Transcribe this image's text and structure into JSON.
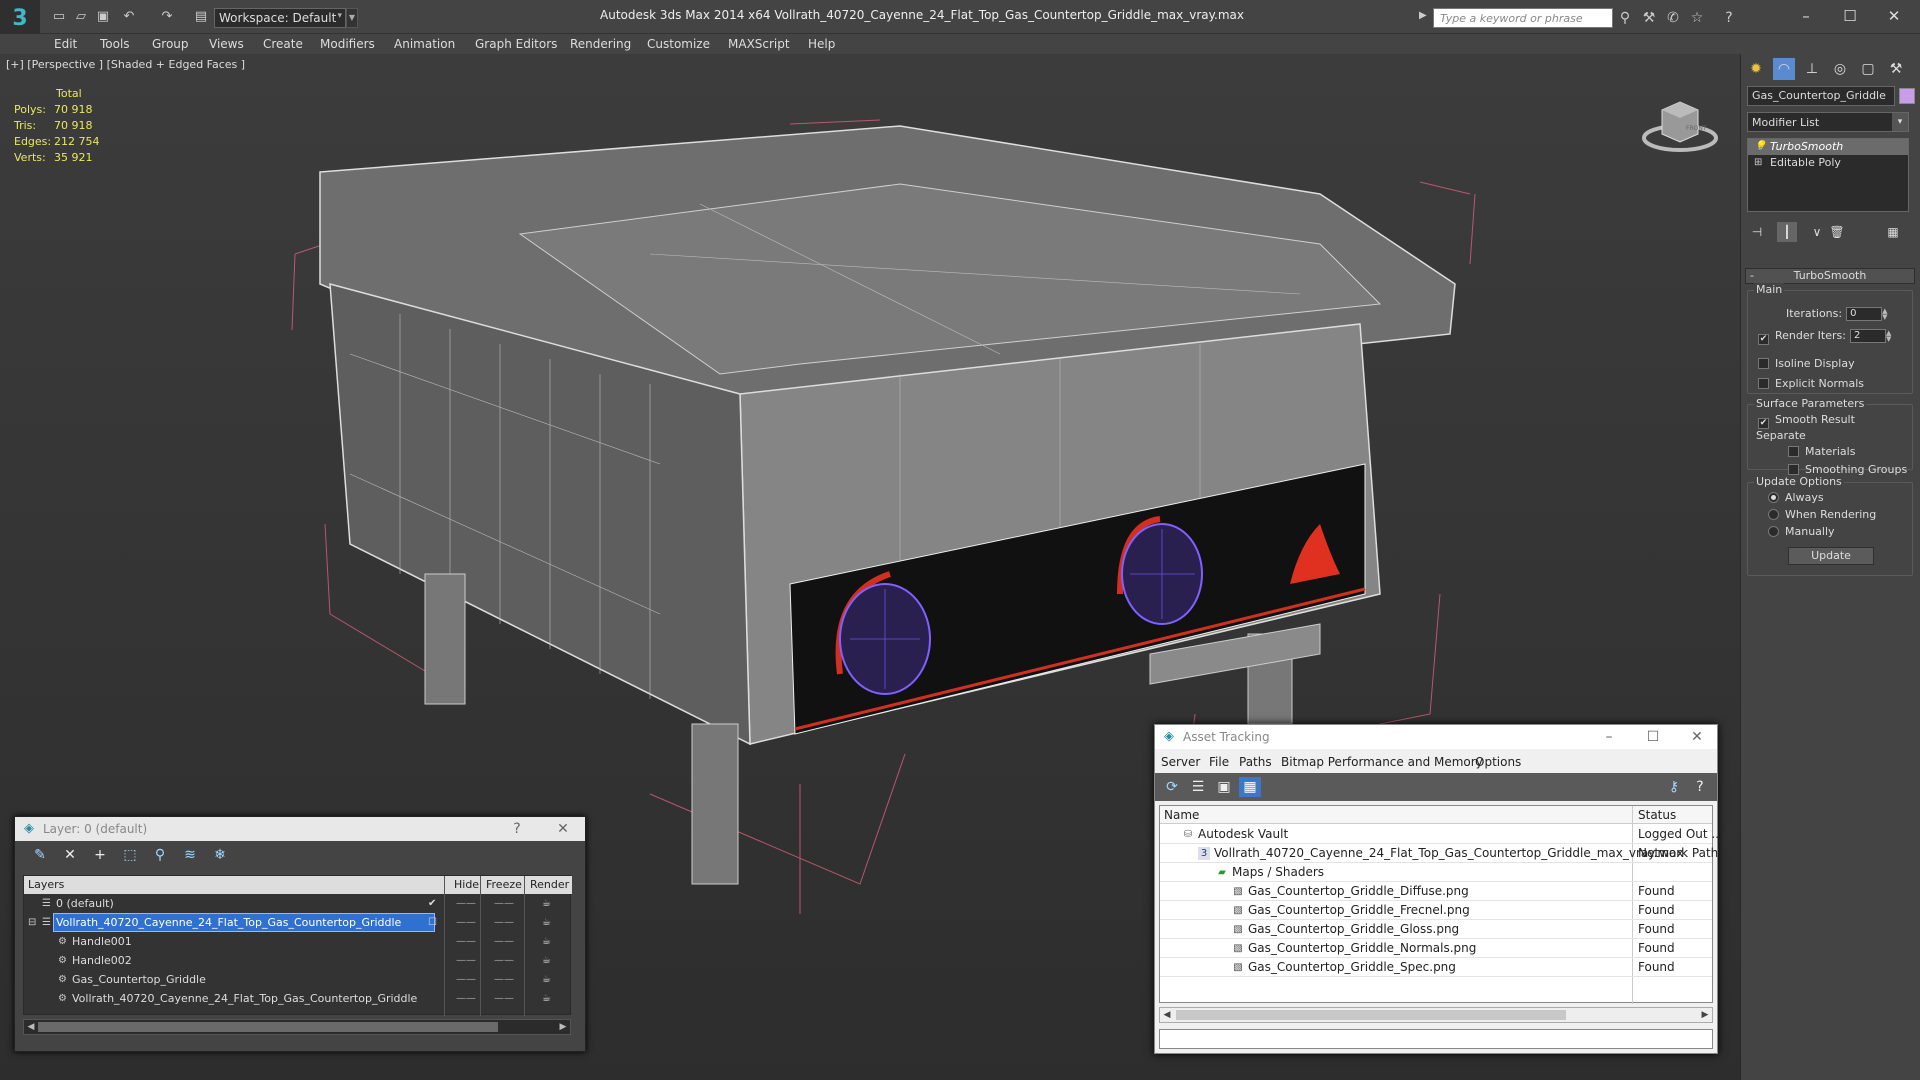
{
  "app": {
    "logo": "3",
    "workspace": "Workspace: Default",
    "title": "Autodesk 3ds Max  2014 x64      Vollrath_40720_Cayenne_24_Flat_Top_Gas_Countertop_Griddle_max_vray.max",
    "search_placeholder": "Type a keyword or phrase"
  },
  "menu": [
    "Edit",
    "Tools",
    "Group",
    "Views",
    "Create",
    "Modifiers",
    "Animation",
    "Graph Editors",
    "Rendering",
    "Customize",
    "MAXScript",
    "Help"
  ],
  "viewport": {
    "label": "[+] [Perspective ] [Shaded + Edged Faces ]",
    "stats_header": "Total",
    "stats": [
      {
        "label": "Polys:",
        "value": "70 918"
      },
      {
        "label": "Tris:",
        "value": "70 918"
      },
      {
        "label": "Edges:",
        "value": "212 754"
      },
      {
        "label": "Verts:",
        "value": "35 921"
      }
    ],
    "viewcube_label": "FRONT"
  },
  "command_panel": {
    "object_name": "Gas_Countertop_Griddle",
    "object_color": "#c89ee8",
    "modifier_list": "Modifier List",
    "stack": [
      {
        "label": "TurboSmooth",
        "selected": true
      },
      {
        "label": "Editable Poly",
        "selected": false
      }
    ],
    "rollout_title": "TurboSmooth",
    "main_group": "Main",
    "iterations_label": "Iterations:",
    "iterations": "0",
    "render_iters_label": "Render Iters:",
    "render_iters": "2",
    "isoline": "Isoline Display",
    "explicit_normals": "Explicit Normals",
    "surface_group": "Surface Parameters",
    "smooth_result": "Smooth Result",
    "separate": "Separate",
    "materials": "Materials",
    "smoothing_groups": "Smoothing Groups",
    "update_group": "Update Options",
    "always": "Always",
    "when_rendering": "When Rendering",
    "manually": "Manually",
    "update_button": "Update"
  },
  "layer_window": {
    "title": "Layer: 0 (default)",
    "help": "?",
    "close": "✕",
    "columns": [
      "Layers",
      "Hide",
      "Freeze",
      "Render"
    ],
    "rows": [
      {
        "name": "0 (default)",
        "indent": 0,
        "selected": false
      },
      {
        "name": "Vollrath_40720_Cayenne_24_Flat_Top_Gas_Countertop_Griddle",
        "indent": 0,
        "selected": true
      },
      {
        "name": "Handle001",
        "indent": 1,
        "selected": false
      },
      {
        "name": "Handle002",
        "indent": 1,
        "selected": false
      },
      {
        "name": "Gas_Countertop_Griddle",
        "indent": 1,
        "selected": false
      },
      {
        "name": "Vollrath_40720_Cayenne_24_Flat_Top_Gas_Countertop_Griddle",
        "indent": 1,
        "selected": false
      }
    ]
  },
  "asset_window": {
    "title": "Asset Tracking",
    "menu": [
      "Server",
      "File",
      "Paths",
      "Bitmap Performance and Memory",
      "Options"
    ],
    "columns": [
      "Name",
      "Status"
    ],
    "rows": [
      {
        "name": "Autodesk Vault",
        "status": "Logged Out ...",
        "indent": 1,
        "icon": "vault"
      },
      {
        "name": "Vollrath_40720_Cayenne_24_Flat_Top_Gas_Countertop_Griddle_max_vray.max",
        "status": "Network Path",
        "indent": 2,
        "icon": "max"
      },
      {
        "name": "Maps / Shaders",
        "status": "",
        "indent": 3,
        "icon": "folder"
      },
      {
        "name": "Gas_Countertop_Griddle_Diffuse.png",
        "status": "Found",
        "indent": 4,
        "icon": "image"
      },
      {
        "name": "Gas_Countertop_Griddle_Frecnel.png",
        "status": "Found",
        "indent": 4,
        "icon": "image"
      },
      {
        "name": "Gas_Countertop_Griddle_Gloss.png",
        "status": "Found",
        "indent": 4,
        "icon": "image"
      },
      {
        "name": "Gas_Countertop_Griddle_Normals.png",
        "status": "Found",
        "indent": 4,
        "icon": "image"
      },
      {
        "name": "Gas_Countertop_Griddle_Spec.png",
        "status": "Found",
        "indent": 4,
        "icon": "image"
      }
    ]
  }
}
